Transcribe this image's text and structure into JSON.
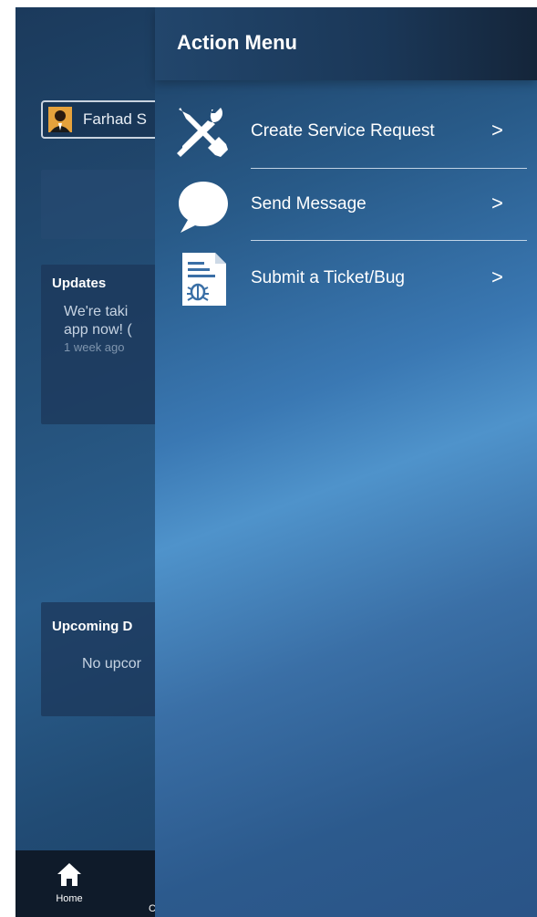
{
  "background_app": {
    "user": {
      "name": "Farhad S"
    },
    "updates": {
      "title": "Updates",
      "line1": "We're taki",
      "line2": "app now! (",
      "time": "1 week ago"
    },
    "upcoming": {
      "title": "Upcoming D",
      "text": "No upcor"
    },
    "bottom_nav": {
      "home_label": "Home",
      "next_label": "C"
    }
  },
  "drawer": {
    "title": "Action Menu",
    "items": [
      {
        "label": "Create Service Request",
        "icon": "tools-icon",
        "chevron": ">"
      },
      {
        "label": "Send Message",
        "icon": "message-bubble-icon",
        "chevron": ">"
      },
      {
        "label": "Submit a Ticket/Bug",
        "icon": "bug-report-icon",
        "chevron": ">"
      }
    ]
  },
  "colors": {
    "drawer_highlight": "#4f93cb",
    "header_dark": "#1a3656",
    "bottom_bar": "#0f1b2a"
  }
}
